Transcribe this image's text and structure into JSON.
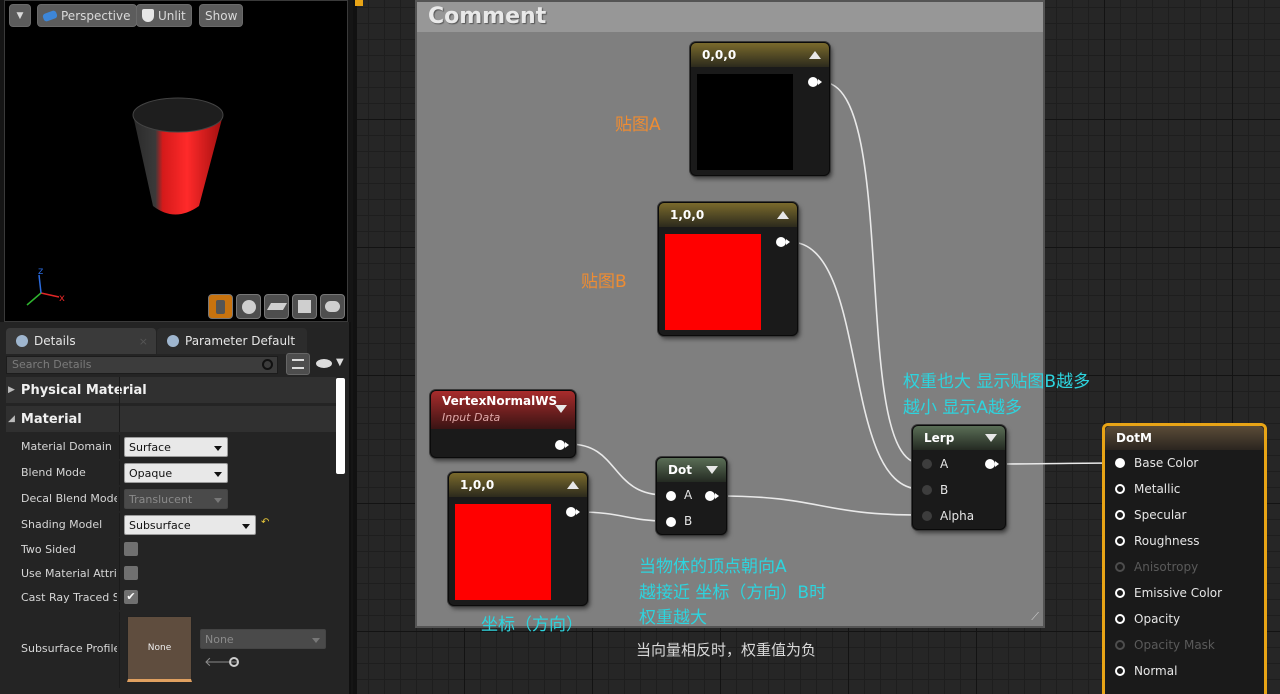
{
  "viewport": {
    "menu_arrow": "▼",
    "perspective_label": "Perspective",
    "unlit_label": "Unlit",
    "show_label": "Show",
    "axis_x": "x",
    "axis_z": "z"
  },
  "tabs": {
    "details": "Details",
    "parameter_defaults": "Parameter Defaults"
  },
  "search": {
    "placeholder": "Search Details"
  },
  "sections": {
    "physical_material": "Physical Material",
    "material": "Material"
  },
  "properties": [
    {
      "label": "Material Domain",
      "type": "combo",
      "value": "Surface"
    },
    {
      "label": "Blend Mode",
      "type": "combo",
      "value": "Opaque"
    },
    {
      "label": "Decal Blend Mode",
      "type": "combo",
      "value": "Translucent",
      "disabled": true
    },
    {
      "label": "Shading Model",
      "type": "combo",
      "value": "Subsurface"
    },
    {
      "label": "Two Sided",
      "type": "check",
      "checked": false
    },
    {
      "label": "Use Material Attributes",
      "type": "check",
      "checked": false
    },
    {
      "label": "Cast Ray Traced Shadows",
      "type": "check",
      "checked": true
    }
  ],
  "subsurface": {
    "label": "Subsurface Profile",
    "thumb": "None",
    "value": "None"
  },
  "comment_title": "Comment",
  "nodes": {
    "const_a": {
      "title": "0,0,0",
      "color": "#000000"
    },
    "const_b": {
      "title": "1,0,0",
      "color": "#ff0000"
    },
    "const_dir": {
      "title": "1,0,0",
      "color": "#ff0000"
    },
    "vertex": {
      "title": "VertexNormalWS",
      "subtitle": "Input Data"
    },
    "dot": {
      "title": "Dot",
      "pin_a": "A",
      "pin_b": "B"
    },
    "lerp": {
      "title": "Lerp",
      "pin_a": "A",
      "pin_b": "B",
      "pin_alpha": "Alpha"
    },
    "result": {
      "title": "DotM",
      "pins": [
        {
          "label": "Base Color",
          "active": true
        },
        {
          "label": "Metallic",
          "active": true
        },
        {
          "label": "Specular",
          "active": true
        },
        {
          "label": "Roughness",
          "active": true
        },
        {
          "label": "Anisotropy",
          "active": false
        },
        {
          "label": "Emissive Color",
          "active": true
        },
        {
          "label": "Opacity",
          "active": true
        },
        {
          "label": "Opacity Mask",
          "active": false
        },
        {
          "label": "Normal",
          "active": true
        }
      ]
    }
  },
  "annotations": {
    "tex_a": "贴图A",
    "tex_b": "贴图B",
    "weight_line1": "权重也大 显示贴图B越多",
    "weight_line2": "越小 显示A越多",
    "dot_line1": "当物体的顶点朝向A",
    "dot_line2": "越接近 坐标（方向）B时",
    "dot_line3": "权重越大",
    "coord": "坐标（方向）",
    "negative": "当向量相反时，权重值为负"
  },
  "colors": {
    "annot_orange": "#ef8c32",
    "annot_cyan": "#2dd4de",
    "cylinder_red": "#ff2020",
    "result_border": "#e8a416"
  }
}
